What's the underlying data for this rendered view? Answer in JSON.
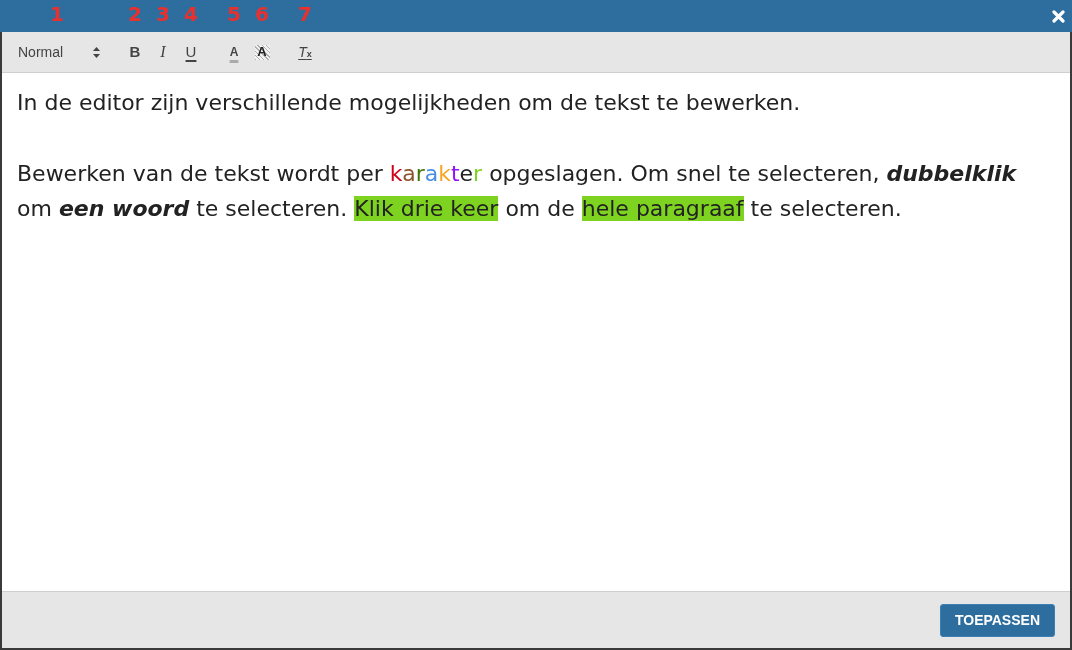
{
  "toolbar": [
    {
      "kind": "select",
      "label": "Normal",
      "callout": "1"
    },
    {
      "kind": "bold",
      "label": "B",
      "callout": "2"
    },
    {
      "kind": "italic",
      "label": "I",
      "callout": "3"
    },
    {
      "kind": "underline",
      "label": "U",
      "callout": "4"
    },
    {
      "kind": "color",
      "label": "A",
      "callout": "5"
    },
    {
      "kind": "background",
      "label": "A",
      "callout": "6"
    },
    {
      "kind": "clean",
      "label": "T$_{x}$",
      "callout": "7"
    }
  ],
  "editor": {
    "paragraphs": [
      {
        "runs": [
          {
            "text": "In de editor zijn verschillende mogelijkheden om de tekst te bewerken.",
            "bold": false,
            "italic": false,
            "highlighted": false
          }
        ]
      },
      {
        "runs": [
          {
            "text": "Bewerken van de tekst wordt per ",
            "bold": false,
            "italic": false,
            "highlighted": false
          },
          {
            "text": "k",
            "color": "#d0021b",
            "bold": false,
            "italic": false,
            "highlighted": false
          },
          {
            "text": "a",
            "color": "#8b572a",
            "bold": false,
            "italic": false,
            "highlighted": false
          },
          {
            "text": "r",
            "color": "#417505",
            "bold": false,
            "italic": false,
            "highlighted": false
          },
          {
            "text": "a",
            "color": "#4a90e2",
            "bold": false,
            "italic": false,
            "highlighted": false
          },
          {
            "text": "k",
            "color": "#f5a623",
            "bold": false,
            "italic": false,
            "highlighted": false
          },
          {
            "text": "t",
            "color": "#9013fe",
            "bold": false,
            "italic": false,
            "highlighted": false
          },
          {
            "text": "e",
            "bold": false,
            "italic": false,
            "highlighted": false
          },
          {
            "text": "r",
            "color": "#7ed321",
            "bold": false,
            "italic": false,
            "highlighted": false
          },
          {
            "text": " opgeslagen. Om snel te selecteren, ",
            "bold": false,
            "italic": false,
            "highlighted": false
          },
          {
            "text": "dubbelklik",
            "bold": true,
            "italic": true,
            "highlighted": false
          },
          {
            "text": " om ",
            "bold": false,
            "italic": false,
            "highlighted": false
          },
          {
            "text": "een woord",
            "bold": true,
            "italic": true,
            "highlighted": false
          },
          {
            "text": " te selecteren. ",
            "bold": false,
            "italic": false,
            "highlighted": false
          },
          {
            "text": "Klik drie keer",
            "bold": false,
            "italic": false,
            "highlighted": true
          },
          {
            "text": " om de ",
            "bold": false,
            "italic": false,
            "highlighted": false
          },
          {
            "text": "hele paragraaf",
            "bold": false,
            "italic": false,
            "highlighted": true
          },
          {
            "text": " te selecteren.",
            "bold": false,
            "italic": false,
            "highlighted": false
          }
        ]
      }
    ]
  },
  "footer": {
    "button": "TOEPASSEN"
  }
}
